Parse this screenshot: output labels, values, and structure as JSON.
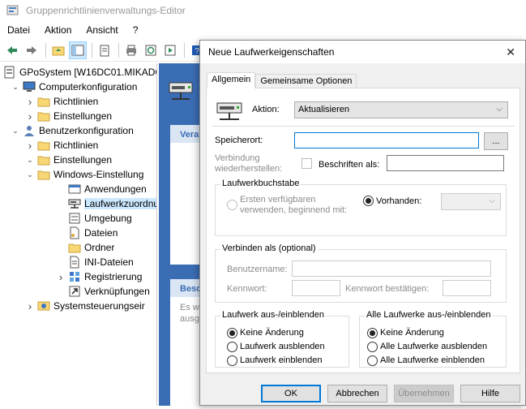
{
  "window": {
    "title": "Gruppenrichtlinienverwaltungs-Editor",
    "menu": [
      "Datei",
      "Aktion",
      "Ansicht",
      "?"
    ]
  },
  "tree": {
    "items": [
      {
        "label": "GPoSystem [W16DC01.MIKADO",
        "level": 0,
        "chevron": "",
        "icon": "policy-icon"
      },
      {
        "label": "Computerkonfiguration",
        "level": 1,
        "chevron": "down",
        "icon": "computer-icon"
      },
      {
        "label": "Richtlinien",
        "level": 2,
        "chevron": "right",
        "icon": "folder-icon"
      },
      {
        "label": "Einstellungen",
        "level": 2,
        "chevron": "right",
        "icon": "folder-icon"
      },
      {
        "label": "Benutzerkonfiguration",
        "level": 1,
        "chevron": "down",
        "icon": "user-icon"
      },
      {
        "label": "Richtlinien",
        "level": 2,
        "chevron": "right",
        "icon": "folder-icon"
      },
      {
        "label": "Einstellungen",
        "level": 2,
        "chevron": "down",
        "icon": "folder-icon"
      },
      {
        "label": "Windows-Einstellung",
        "level": 3,
        "chevron": "down",
        "icon": "folder-icon"
      },
      {
        "label": "Anwendungen",
        "level": 4,
        "chevron": "",
        "icon": "applications-icon"
      },
      {
        "label": "Laufwerkzuordnu",
        "level": 4,
        "chevron": "",
        "icon": "drive-map-icon",
        "selected": true
      },
      {
        "label": "Umgebung",
        "level": 4,
        "chevron": "",
        "icon": "environment-icon"
      },
      {
        "label": "Dateien",
        "level": 4,
        "chevron": "",
        "icon": "files-icon"
      },
      {
        "label": "Ordner",
        "level": 4,
        "chevron": "",
        "icon": "folder-icon"
      },
      {
        "label": "INI-Dateien",
        "level": 4,
        "chevron": "",
        "icon": "ini-files-icon"
      },
      {
        "label": "Registrierung",
        "level": 4,
        "chevron": "right",
        "icon": "registry-icon"
      },
      {
        "label": "Verknüpfungen",
        "level": 4,
        "chevron": "",
        "icon": "shortcuts-icon"
      },
      {
        "label": "Systemsteuerungseir",
        "level": 3,
        "chevron": "right",
        "icon": "control-panel-icon"
      }
    ]
  },
  "rightpane": {
    "box1_header": "Vera",
    "box2_header": "Besc",
    "box2_text_1": "Es w",
    "box2_text_2": "ausg"
  },
  "dialog": {
    "title": "Neue Laufwerkeigenschaften",
    "tabs": [
      "Allgemein",
      "Gemeinsame Optionen"
    ],
    "action_label": "Aktion:",
    "action_value": "Aktualisieren",
    "location_label": "Speicherort:",
    "location_value": "",
    "browse_label": "...",
    "reconnect_label_1": "Verbindung",
    "reconnect_label_2": "wiederherstellen:",
    "label_as_label": "Beschriften als:",
    "label_as_value": "",
    "drive_letter_group": "Laufwerkbuchstabe",
    "first_available_1": "Ersten verfügbaren",
    "first_available_2": "verwenden, beginnend mit:",
    "existing_label": "Vorhanden:",
    "existing_value": "",
    "connect_as_group": "Verbinden als (optional)",
    "username_label": "Benutzername:",
    "password_label": "Kennwort:",
    "confirm_password_label": "Kennwort bestätigen:",
    "hide_drive_group": "Laufwerk aus-/einblenden",
    "hide_drive_options": [
      "Keine Änderung",
      "Laufwerk ausblenden",
      "Laufwerk einblenden"
    ],
    "hide_all_group": "Alle Laufwerke aus-/einblenden",
    "hide_all_options": [
      "Keine Änderung",
      "Alle Laufwerke ausblenden",
      "Alle Laufwerke einblenden"
    ],
    "buttons": {
      "ok": "OK",
      "cancel": "Abbrechen",
      "apply": "Übernehmen",
      "help": "Hilfe"
    }
  }
}
